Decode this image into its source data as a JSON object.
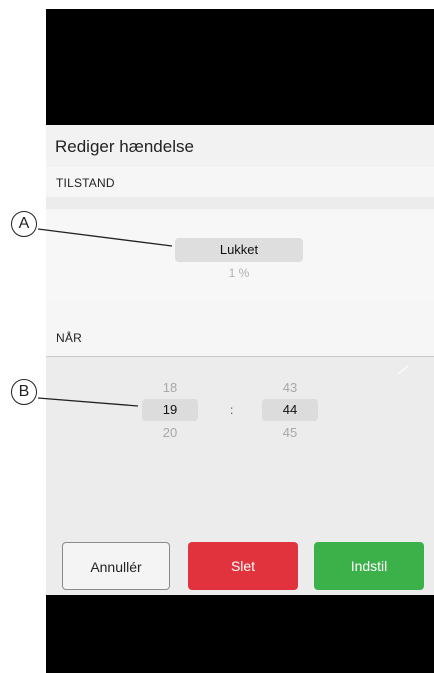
{
  "dialog": {
    "title": "Rediger hændelse",
    "state_section_label": "TILSTAND",
    "state_value": "Lukket",
    "state_percent": "1 %",
    "when_section_label": "NÅR",
    "hours": {
      "prev": "18",
      "selected": "19",
      "next": "20"
    },
    "separator": ":",
    "minutes": {
      "prev": "43",
      "selected": "44",
      "next": "45"
    }
  },
  "buttons": {
    "cancel": "Annullér",
    "delete": "Slet",
    "set": "Indstil"
  },
  "callouts": {
    "a": "A",
    "b": "B"
  },
  "colors": {
    "delete": "#e0333d",
    "set": "#3cb14a",
    "background": "#000000"
  }
}
